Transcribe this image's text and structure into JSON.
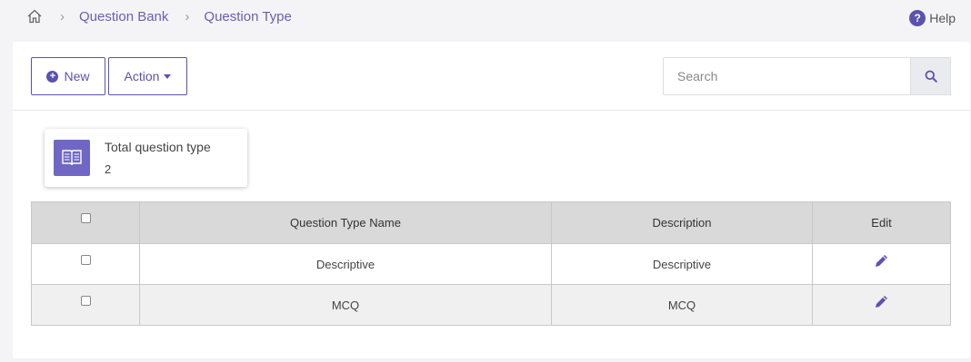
{
  "breadcrumb": {
    "items": [
      "Question Bank",
      "Question Type"
    ]
  },
  "help_label": "Help",
  "toolbar": {
    "new_label": "New",
    "action_label": "Action",
    "search_placeholder": "Search"
  },
  "stat": {
    "label": "Total question type",
    "value": "2"
  },
  "table": {
    "headers": [
      "Question Type Name",
      "Description",
      "Edit"
    ],
    "rows": [
      {
        "name": "Descriptive",
        "description": "Descriptive"
      },
      {
        "name": "MCQ",
        "description": "MCQ"
      }
    ]
  },
  "colors": {
    "accent": "#5b52b0",
    "icon_bg": "#7067c4"
  },
  "icons": [
    "home-icon",
    "chevron-right-icon",
    "help-icon",
    "plus-circle-icon",
    "caret-down-icon",
    "search-icon",
    "book-icon",
    "pencil-icon"
  ]
}
